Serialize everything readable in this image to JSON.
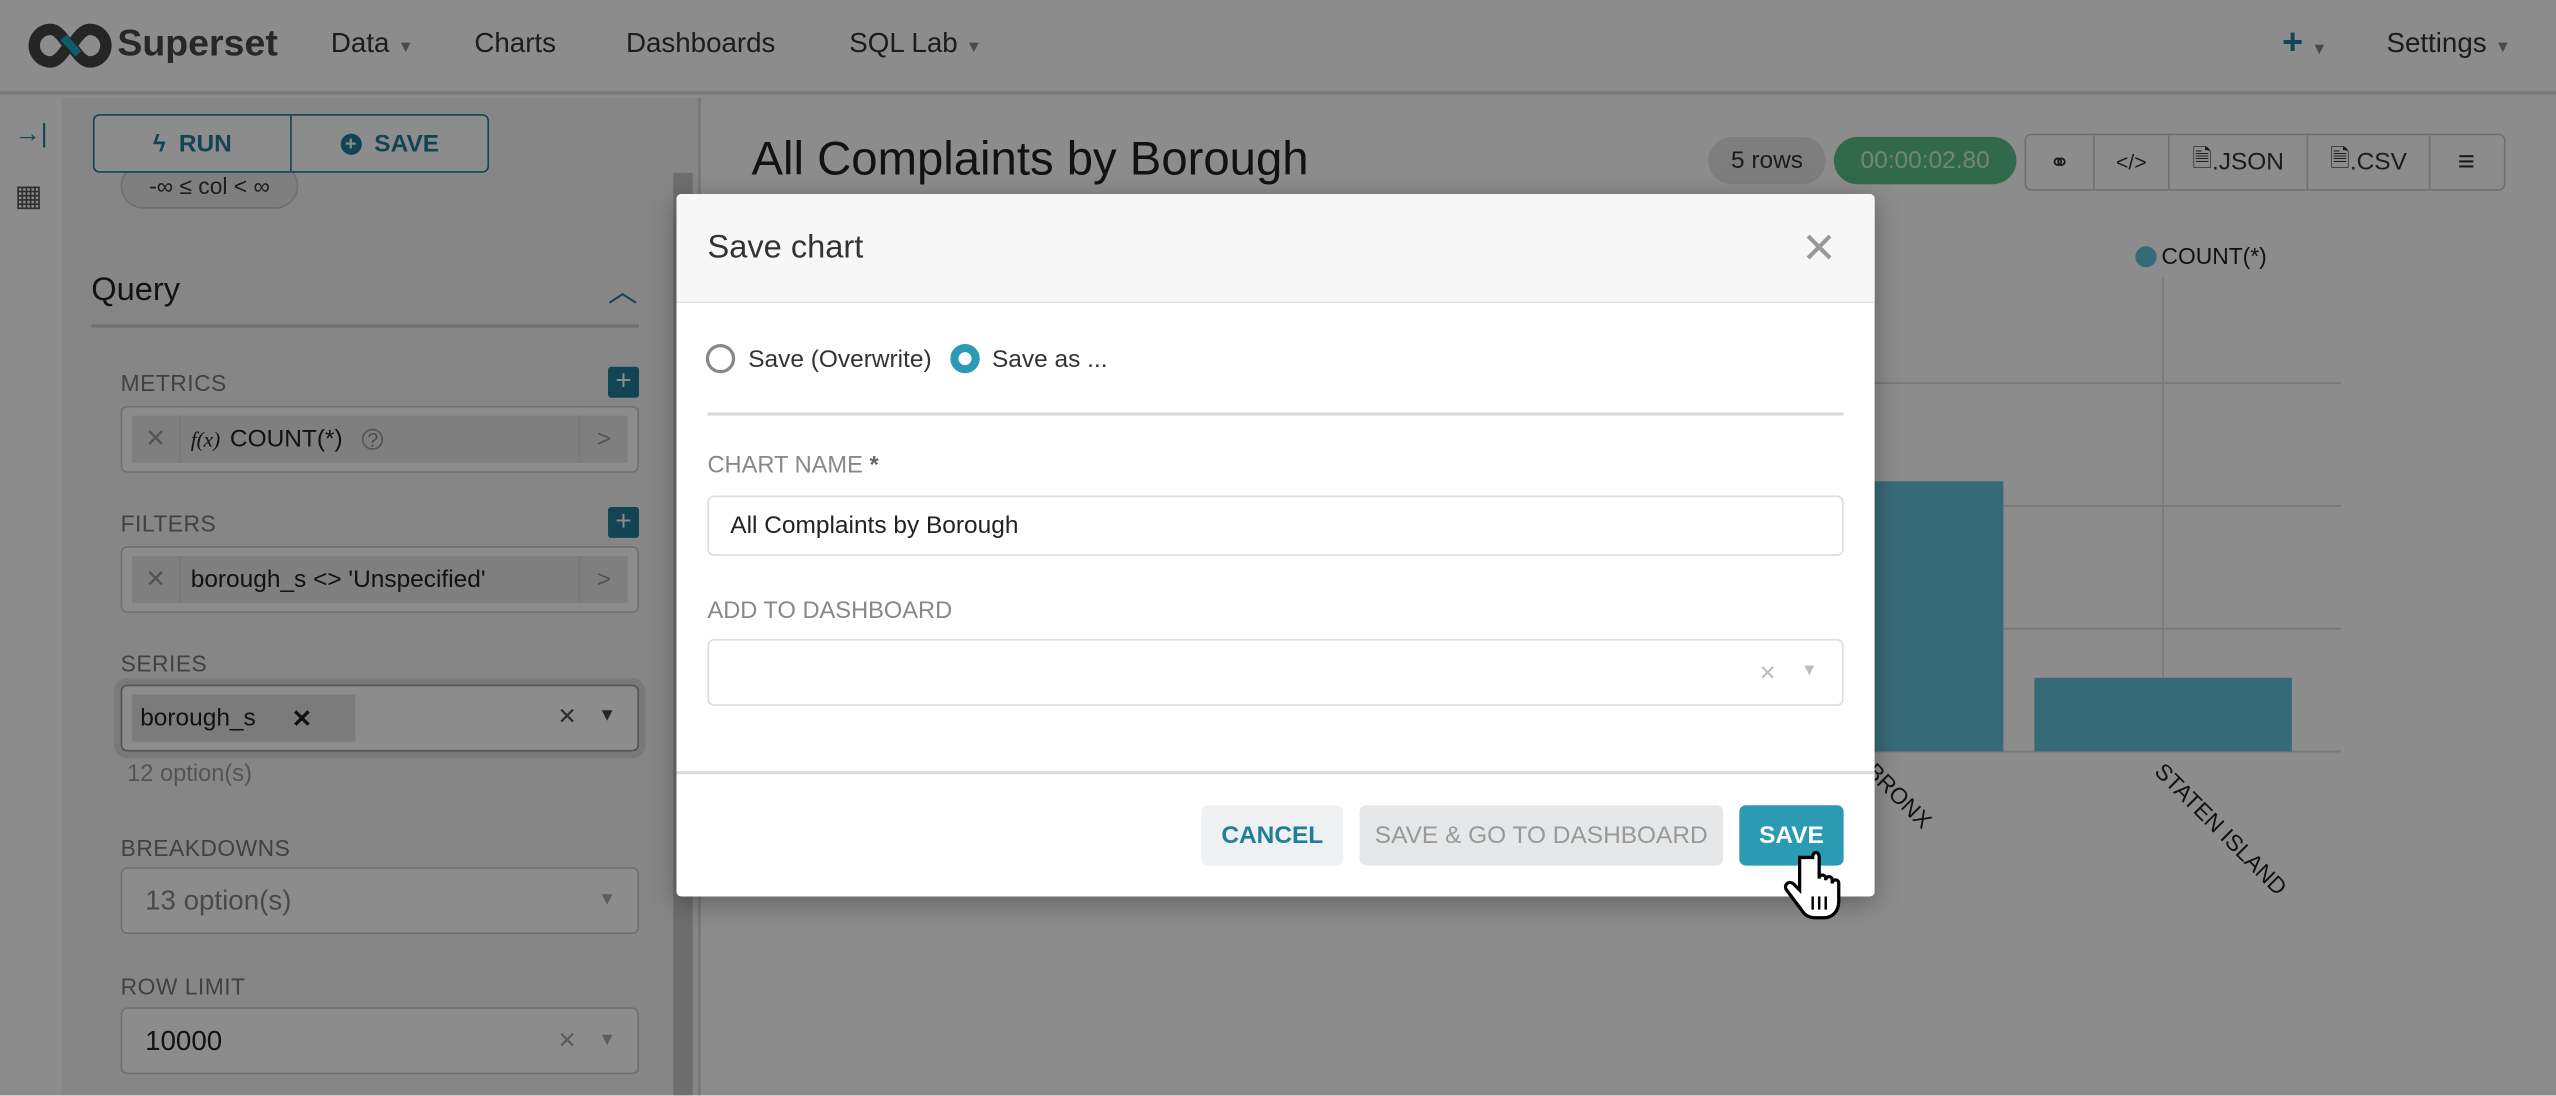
{
  "navbar": {
    "brand": "Superset",
    "items": [
      {
        "label": "Data",
        "dropdown": true
      },
      {
        "label": "Charts"
      },
      {
        "label": "Dashboards"
      },
      {
        "label": "SQL Lab",
        "dropdown": true
      }
    ],
    "add_icon": "plus-icon",
    "settings": "Settings"
  },
  "toolbar": {
    "run": "RUN",
    "save": "SAVE",
    "range_pill": "-∞ ≤ col < ∞"
  },
  "query": {
    "title": "Query",
    "metrics": {
      "label": "METRICS",
      "value": "COUNT(*)",
      "prefix": "f(x)"
    },
    "filters": {
      "label": "FILTERS",
      "value": "borough_s <> 'Unspecified'"
    },
    "series": {
      "label": "SERIES",
      "value": "borough_s",
      "hint": "12 option(s)"
    },
    "breakdowns": {
      "label": "BREAKDOWNS",
      "placeholder": "13 option(s)"
    },
    "row_limit": {
      "label": "ROW LIMIT",
      "value": "10000"
    }
  },
  "chart": {
    "title": "All Complaints by Borough",
    "rows": "5 rows",
    "timer": "00:00:02.80",
    "actions": [
      ".JSON",
      ".CSV"
    ]
  },
  "colors": {
    "accent": "#1f7f99",
    "bar": "#64c1da",
    "timer": "#5ac189",
    "primary_button": "#2a9bb3"
  },
  "chart_data": {
    "type": "bar",
    "categories": [
      "BRONX",
      "STATEN ISLAND"
    ],
    "series": [
      {
        "name": "COUNT(*)",
        "values": [
          2.2,
          0.6
        ]
      }
    ],
    "ylim": [
      0,
      3
    ],
    "grid": true,
    "legend": "top-right"
  },
  "modal": {
    "title": "Save chart",
    "options": [
      {
        "label": "Save (Overwrite)",
        "selected": false
      },
      {
        "label": "Save as ...",
        "selected": true
      }
    ],
    "chart_name_label": "CHART NAME",
    "required": "*",
    "chart_name_value": "All Complaints by Borough",
    "dashboard_label": "ADD TO DASHBOARD",
    "dashboard_value": "",
    "cancel": "CANCEL",
    "save_go": "SAVE & GO TO DASHBOARD",
    "save": "SAVE"
  }
}
